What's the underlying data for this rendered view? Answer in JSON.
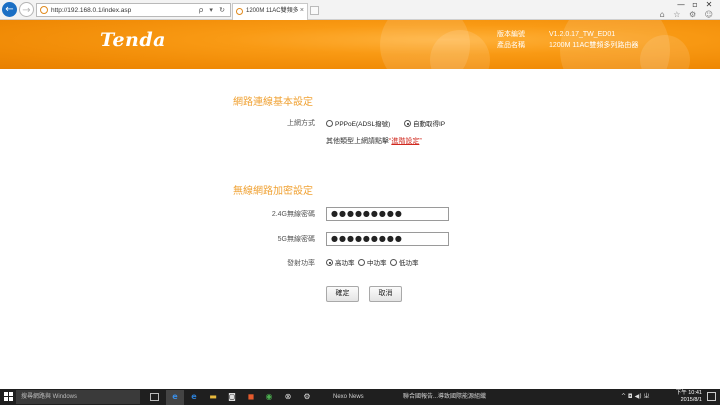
{
  "browser": {
    "url": "http://192.168.0.1/index.asp",
    "tab_title": "1200M 11AC雙頻多列路由...",
    "tab_close": "×",
    "back": "←",
    "forward": "→",
    "address_icons": "ρ ▾ ↻",
    "window_controls": [
      "—",
      "▫",
      "✕"
    ],
    "toolbar_icons": "⌂ ☆ ⚙ ☺"
  },
  "router": {
    "logo": "Tenda",
    "info": [
      {
        "key": "版本編號",
        "value": "V1.2.0.17_TW_ED01"
      },
      {
        "key": "產品名稱",
        "value": "1200M 11AC雙頻多列路由器"
      }
    ]
  },
  "wan": {
    "title": "網路連線基本設定",
    "label": "上網方式",
    "options": [
      "PPPoE(ADSL撥號)",
      "自動取得IP"
    ],
    "selected": "自動取得IP",
    "hint_prefix": "其他類型上網請點擊",
    "hint_open": "“",
    "hint_link": "進階設定",
    "hint_close": "”"
  },
  "wireless": {
    "title": "無線網路加密設定",
    "pwd24_label": "2.4G無線密碼",
    "pwd24_value": "●●●●●●●●●",
    "pwd5_label": "5G無線密碼",
    "pwd5_value": "●●●●●●●●●",
    "power_label": "發射功率",
    "power_options": [
      "高功率",
      "中功率",
      "低功率"
    ],
    "power_selected": "高功率"
  },
  "buttons": {
    "ok": "確定",
    "cancel": "取消"
  },
  "taskbar": {
    "search": "搜尋網路與 Windows",
    "news": "Nexo News",
    "ticker": "聯合國報告...導致國際能源組織",
    "tray": "^ ◘ ◀) ㄓ",
    "time": "下午 10:41",
    "date": "2015/8/1"
  }
}
